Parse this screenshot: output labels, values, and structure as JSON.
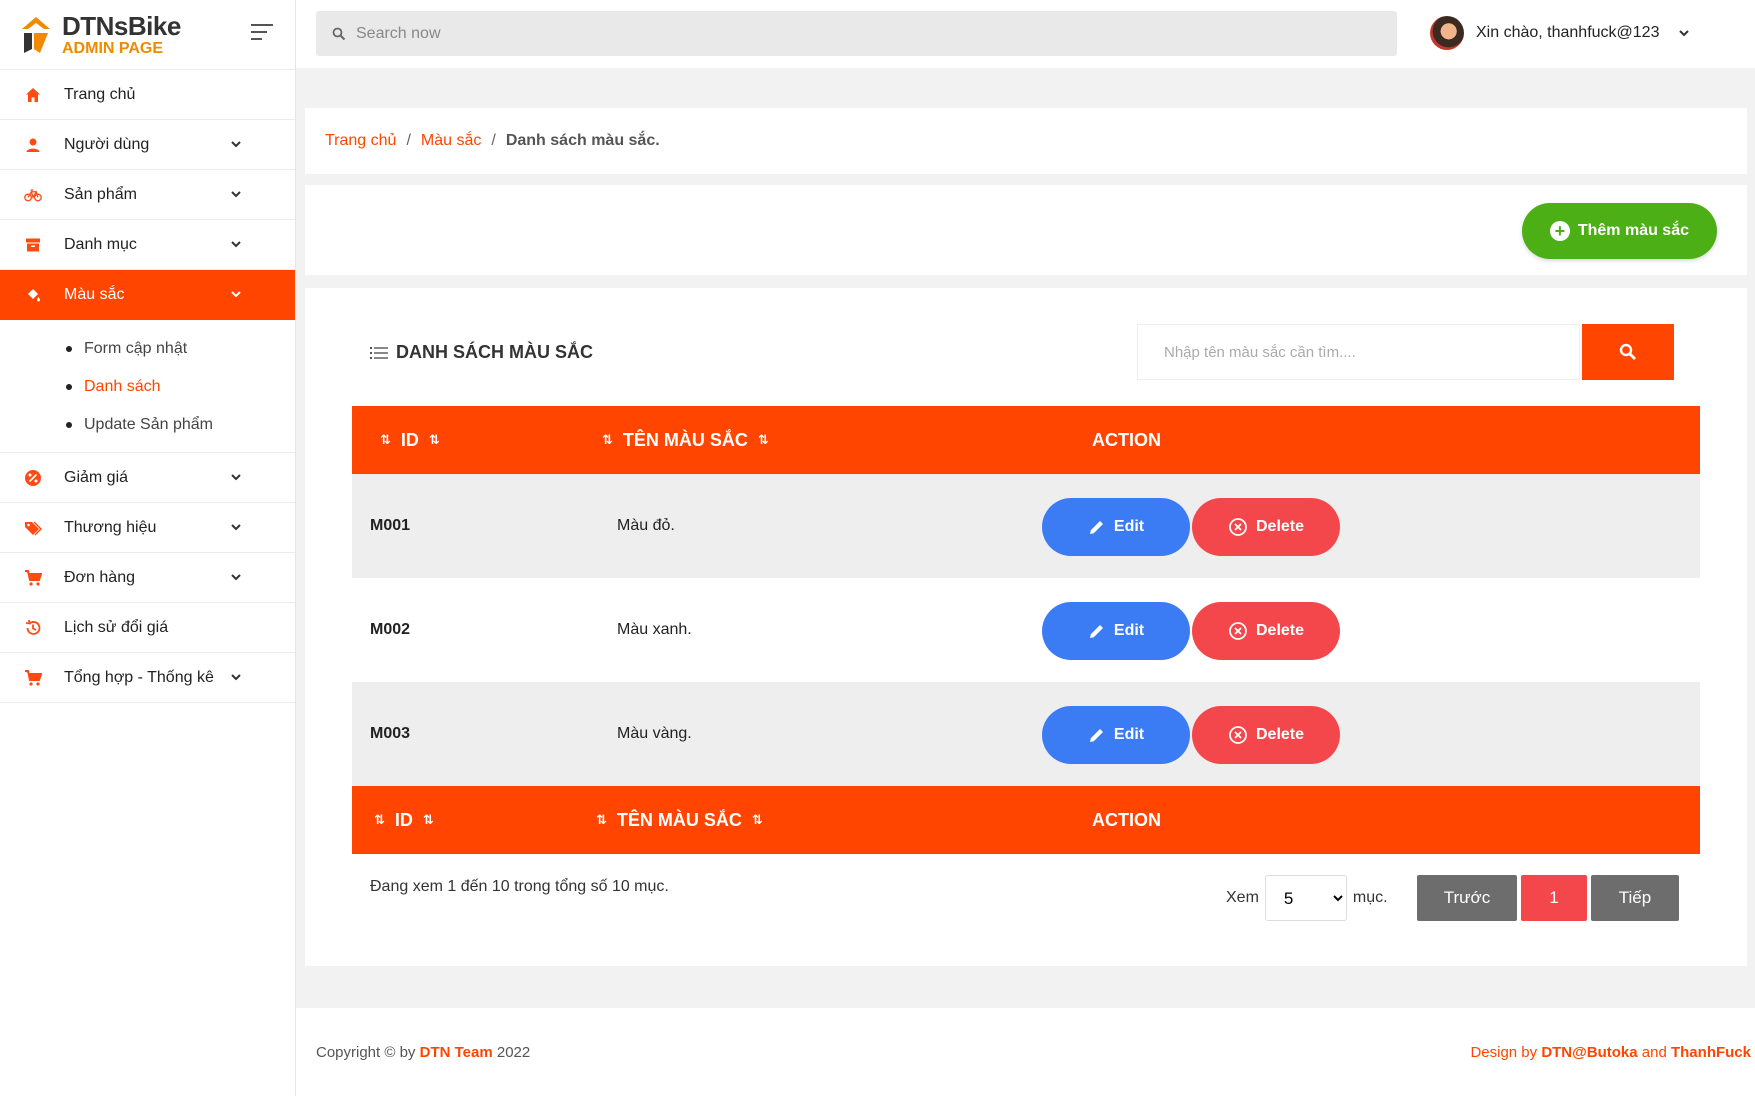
{
  "brand": {
    "name": "DTNsBike",
    "subtitle": "ADMIN PAGE"
  },
  "topbar": {
    "search_placeholder": "Search now",
    "greeting": "Xin chào, thanhfuck@123"
  },
  "sidebar": {
    "items": [
      {
        "label": "Trang chủ",
        "icon": "home-icon"
      },
      {
        "label": "Người dùng",
        "icon": "user-icon"
      },
      {
        "label": "Sản phẩm",
        "icon": "bicycle-icon"
      },
      {
        "label": "Danh mục",
        "icon": "archive-icon"
      },
      {
        "label": "Màu sắc",
        "icon": "paint-bucket-icon"
      },
      {
        "label": "Giảm giá",
        "icon": "discount-icon"
      },
      {
        "label": "Thương hiệu",
        "icon": "tags-icon"
      },
      {
        "label": "Đơn hàng",
        "icon": "cart-icon"
      },
      {
        "label": "Lịch sử đổi giá",
        "icon": "history-icon"
      },
      {
        "label": "Tổng hợp - Thống kê",
        "icon": "cart-icon"
      }
    ],
    "submenu": [
      {
        "label": "Form cập nhật"
      },
      {
        "label": "Danh sách"
      },
      {
        "label": "Update Sản phẩm"
      }
    ]
  },
  "breadcrumb": {
    "home": "Trang chủ",
    "section": "Màu sắc",
    "current": "Danh sách màu sắc.",
    "sep": "/"
  },
  "add_button": "Thêm màu sắc",
  "list": {
    "title": "DANH SÁCH MÀU SẮC",
    "search_placeholder": "Nhập tên màu sắc cần tìm....",
    "columns": {
      "id": "ID",
      "name": "TÊN MÀU SẮC",
      "action": "ACTION"
    },
    "rows": [
      {
        "id": "M001",
        "name": "Màu đỏ."
      },
      {
        "id": "M002",
        "name": "Màu xanh."
      },
      {
        "id": "M003",
        "name": "Màu vàng."
      }
    ],
    "edit_label": "Edit",
    "delete_label": "Delete",
    "info": "Đang xem 1 đến 10 trong tổng số 10 mục.",
    "per_page_prefix": "Xem",
    "per_page_value": "5",
    "per_page_suffix": "mục.",
    "prev": "Trước",
    "page": "1",
    "next": "Tiếp"
  },
  "footer": {
    "copyright_pre": "Copyright © by",
    "team": "DTN Team",
    "year": "2022",
    "design_pre": "Design by",
    "author1": "DTN@Butoka",
    "and": "and",
    "author2": "ThanhFuck"
  },
  "colors": {
    "accent": "#ff4500",
    "green": "#4caf15",
    "edit": "#3b7cf5",
    "delete": "#f4474b"
  }
}
